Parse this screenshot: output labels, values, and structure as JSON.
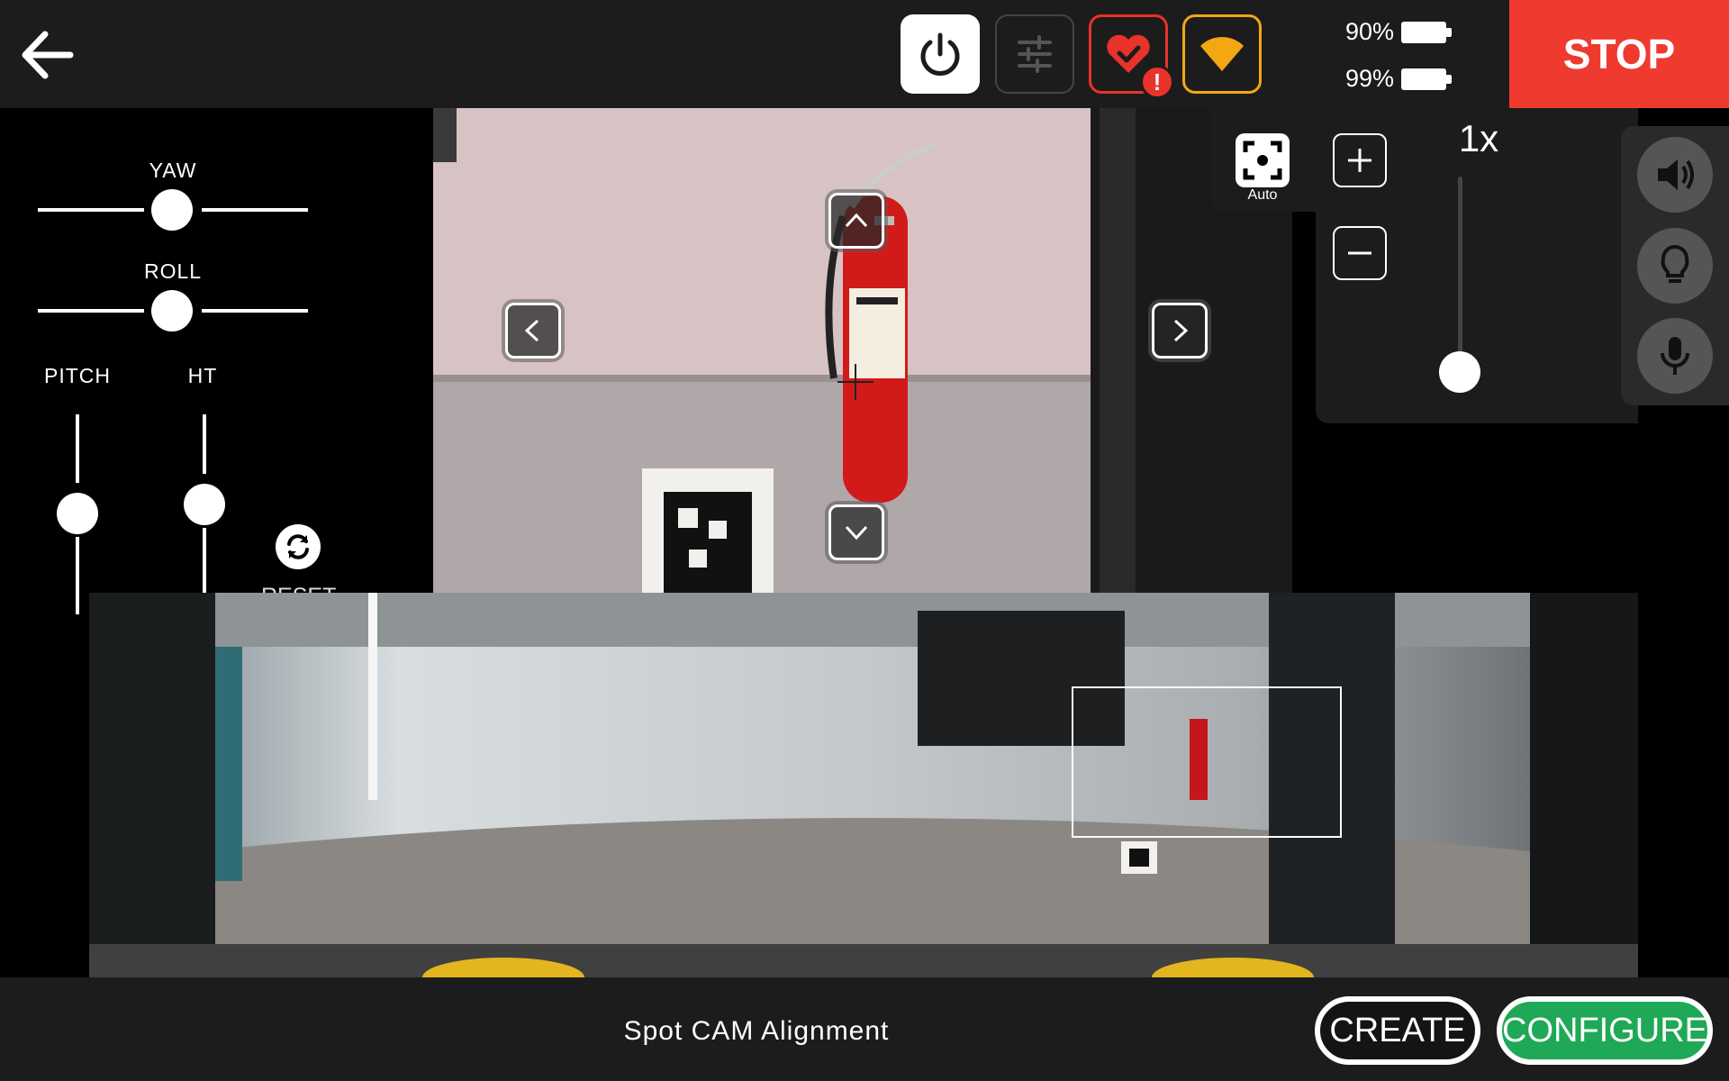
{
  "header": {
    "battery_1": "90%",
    "battery_2": "99%",
    "stop_label": "STOP",
    "health_alert": "!"
  },
  "left_panel": {
    "yaw_label": "YAW",
    "roll_label": "ROLL",
    "pitch_label": "PITCH",
    "ht_label": "HT",
    "reset_label": "RESET"
  },
  "zoom": {
    "auto_label": "Auto",
    "level": "1x"
  },
  "bottom": {
    "mission_name": "Spot CAM Alignment",
    "create_label": "CREATE",
    "configure_label": "CONFIGURE"
  },
  "colors": {
    "stop": "#ee3a2f",
    "health_alert": "#e8322a",
    "wifi": "#f3a712",
    "configure": "#1fa855"
  },
  "icons": [
    "back-arrow-icon",
    "power-icon",
    "sliders-icon",
    "heart-check-icon",
    "wifi-icon",
    "battery-icon",
    "reset-icon",
    "focus-auto-icon",
    "plus-icon",
    "minus-icon",
    "speaker-icon",
    "lightbulb-icon",
    "microphone-icon",
    "chevron-up-icon",
    "chevron-down-icon",
    "chevron-left-icon",
    "chevron-right-icon"
  ]
}
